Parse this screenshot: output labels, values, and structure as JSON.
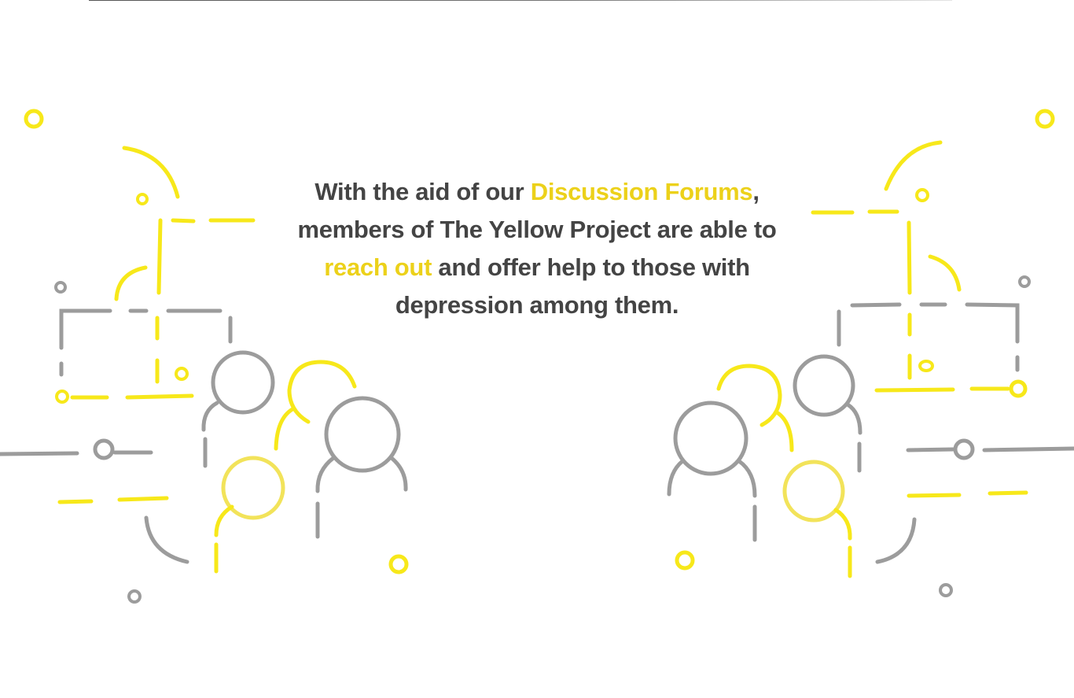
{
  "message": {
    "line1_start": "With the aid of our ",
    "line1_highlight": "Discussion Forums",
    "line1_end": ",",
    "line2": "members of  The Yellow Project are able to",
    "line3_highlight": "reach out",
    "line3_end": " and offer help to those with",
    "line4": "depression among them."
  },
  "colors": {
    "text": "#444444",
    "highlight": "#ecd11a",
    "yellow_stroke": "#f7e81a",
    "pale_yellow_stroke": "#f2e35a",
    "gray_stroke": "#9c9c9c"
  },
  "illustration": {
    "left": "people-network-illustration-left",
    "right": "people-network-illustration-right"
  }
}
